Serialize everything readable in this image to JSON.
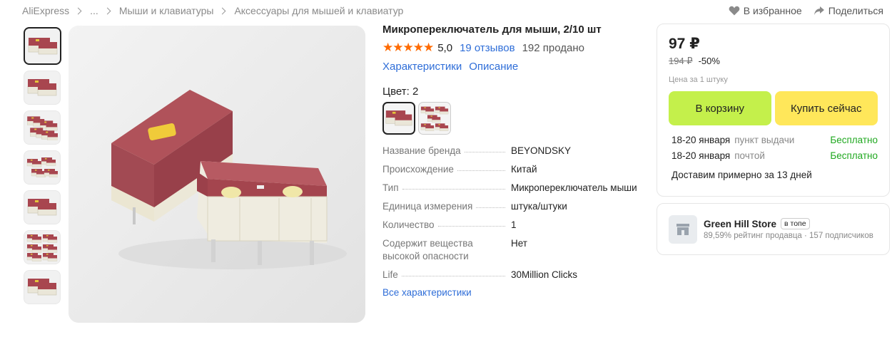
{
  "breadcrumb": {
    "items": [
      "AliExpress",
      "...",
      "Мыши и клавиатуры",
      "Аксессуары для мышей и клавиатур"
    ]
  },
  "top_actions": {
    "favorite": "В избранное",
    "share": "Поделиться"
  },
  "product": {
    "title": "Микропереключатель для мыши, 2/10 шт",
    "stars": "★★★★★",
    "rating": "5,0",
    "reviews": "19 отзывов",
    "sold": "192 продано",
    "tab_specs": "Характеристики",
    "tab_description": "Описание",
    "color_label": "Цвет: 2"
  },
  "specs": [
    {
      "key": "Название бренда",
      "value": "BEYONDSKY"
    },
    {
      "key": "Происхождение",
      "value": "Китай"
    },
    {
      "key": "Тип",
      "value": "Микропереключатель мыши"
    },
    {
      "key": "Единица измерения",
      "value": "штука/штуки"
    },
    {
      "key": "Количество",
      "value": "1"
    },
    {
      "key": "Содержит вещества высокой опасности",
      "value": "Нет"
    },
    {
      "key": "Life",
      "value": "30Million Clicks"
    }
  ],
  "all_specs_link": "Все характеристики",
  "price_card": {
    "price": "97 ₽",
    "old_price": "194 ₽",
    "discount": "-50%",
    "unit_note": "Цена за 1 штуку",
    "cart_button": "В корзину",
    "buy_button": "Купить сейчас",
    "delivery": [
      {
        "date": "18-20 января",
        "method": "пункт выдачи",
        "price": "Бесплатно"
      },
      {
        "date": "18-20 января",
        "method": "почтой",
        "price": "Бесплатно"
      }
    ],
    "delivery_note": "Доставим примерно за 13 дней"
  },
  "store": {
    "name": "Green Hill Store",
    "badge": "в топе",
    "meta": "89,59% рейтинг продавца · 157 подписчиков"
  },
  "colors": {
    "accent_link": "#2f6ed8",
    "star": "#ff6a00",
    "cart_btn": "#c4f04b",
    "buy_btn": "#ffe75a",
    "free": "#1fa81f"
  }
}
